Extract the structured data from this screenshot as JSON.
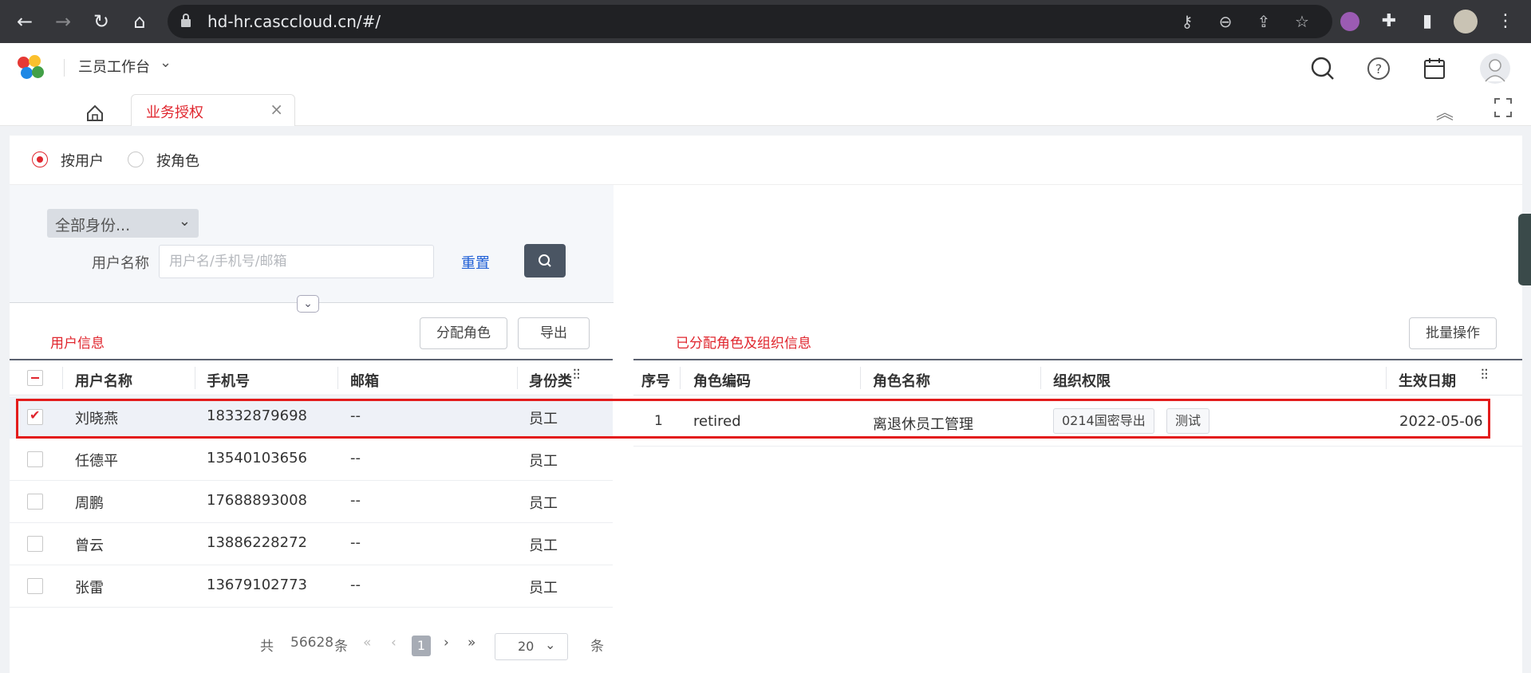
{
  "browser": {
    "url": "hd-hr.casccloud.cn/#/",
    "nav_icons": [
      "back-arrow-icon",
      "forward-arrow-icon",
      "reload-icon",
      "home-icon"
    ],
    "addr_icons": [
      "key-icon",
      "zoom-out-icon",
      "share-icon",
      "star-icon"
    ]
  },
  "app": {
    "workbench_label": "三员工作台",
    "header_icons": [
      "search-icon",
      "help-icon",
      "calendar-icon",
      "user-avatar-icon"
    ],
    "active_tab_label": "业务授权",
    "close_glyph": "×"
  },
  "filter_mode": {
    "options": [
      {
        "label": "按用户",
        "selected": true
      },
      {
        "label": "按角色",
        "selected": false
      }
    ]
  },
  "filter": {
    "identity_select_value": "全部身份...",
    "username_label": "用户名称",
    "username_placeholder": "用户名/手机号/邮箱",
    "reset_label": "重置"
  },
  "user_panel": {
    "title": "用户信息",
    "assign_role_label": "分配角色",
    "export_label": "导出",
    "columns": [
      "用户名称",
      "手机号",
      "邮箱",
      "身份类"
    ],
    "rows": [
      {
        "name": "刘晓燕",
        "phone": "18332879698",
        "email": "--",
        "identity": "员工",
        "checked": true
      },
      {
        "name": "任德平",
        "phone": "13540103656",
        "email": "--",
        "identity": "员工",
        "checked": false
      },
      {
        "name": "周鹏",
        "phone": "17688893008",
        "email": "--",
        "identity": "员工",
        "checked": false
      },
      {
        "name": "曾云",
        "phone": "13886228272",
        "email": "--",
        "identity": "员工",
        "checked": false
      },
      {
        "name": "张雷",
        "phone": "13679102773",
        "email": "--",
        "identity": "员工",
        "checked": false
      }
    ]
  },
  "role_panel": {
    "title": "已分配角色及组织信息",
    "batch_label": "批量操作",
    "columns": [
      "序号",
      "角色编码",
      "角色名称",
      "组织权限",
      "生效日期"
    ],
    "rows": [
      {
        "index": "1",
        "code": "retired",
        "name": "离退休员工管理",
        "orgs": [
          "0214国密导出",
          "测试"
        ],
        "date": "2022-05-06"
      }
    ]
  },
  "pagination": {
    "total_prefix": "共",
    "total": "56628",
    "total_suffix": "条",
    "current_page": "1",
    "page_size": "20",
    "size_suffix": "条"
  },
  "colors": {
    "accent": "#e0262e",
    "highlight_box": "#e31c1c",
    "link": "#1f5fd6",
    "chrome": "#35363a"
  }
}
